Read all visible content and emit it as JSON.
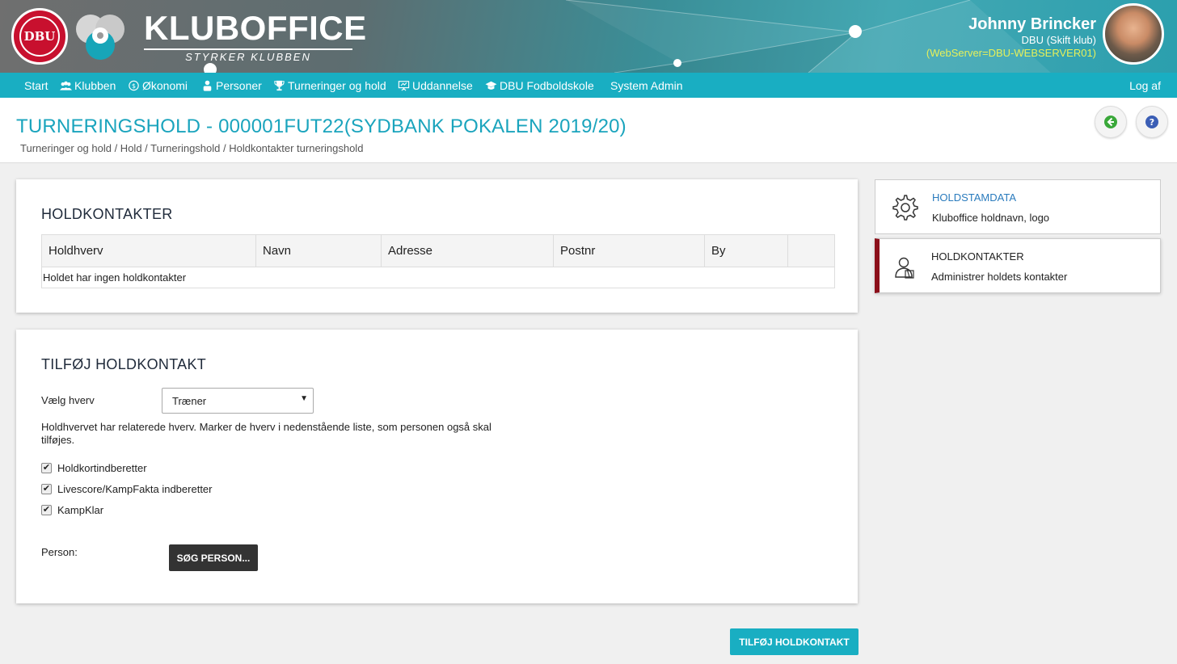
{
  "header": {
    "brand_name": "KLUBOFFICE",
    "brand_tagline": "STYRKER KLUBBEN",
    "logo_text": "DBU",
    "user_name": "Johnny Brincker",
    "user_club": "DBU (Skift klub)",
    "server": "(WebServer=DBU-WEBSERVER01)"
  },
  "nav": {
    "items": [
      {
        "label": "Start",
        "icon": ""
      },
      {
        "label": "Klubben",
        "icon": "people-icon"
      },
      {
        "label": "Økonomi",
        "icon": "coin-icon"
      },
      {
        "label": "Personer",
        "icon": "person-icon"
      },
      {
        "label": "Turneringer og hold",
        "icon": "trophy-icon"
      },
      {
        "label": "Uddannelse",
        "icon": "presentation-icon"
      },
      {
        "label": "DBU Fodboldskole",
        "icon": "graduation-cap-icon"
      },
      {
        "label": "System Admin",
        "icon": ""
      }
    ],
    "logout": "Log af"
  },
  "page": {
    "title": "TURNERINGSHOLD - 000001FUT22(SYDBANK POKALEN 2019/20)",
    "breadcrumb": "Turneringer og hold / Hold / Turneringshold / Holdkontakter turneringshold"
  },
  "contacts": {
    "heading": "HOLDKONTAKTER",
    "columns": [
      "Holdhverv",
      "Navn",
      "Adresse",
      "Postnr",
      "By",
      ""
    ],
    "empty_text": "Holdet har ingen holdkontakter"
  },
  "add_contact": {
    "heading": "TILFØJ HOLDKONTAKT",
    "role_label": "Vælg hverv",
    "role_value": "Træner",
    "info_text_line1": "Holdhvervet har relaterede hverv. Marker de hverv i nedenstående liste, som personen også skal",
    "info_text_line2": "tilføjes.",
    "related_roles": [
      {
        "label": "Holdkortindberetter",
        "checked": true
      },
      {
        "label": "Livescore/KampFakta indberetter",
        "checked": true
      },
      {
        "label": "KampKlar",
        "checked": true
      }
    ],
    "person_label": "Person:",
    "search_button": "SØG PERSON...",
    "submit_button": "TILFØJ HOLDKONTAKT"
  },
  "sidebar": {
    "items": [
      {
        "title": "HOLDSTAMDATA",
        "desc": "Kluboffice holdnavn, logo",
        "icon": "gear-icon",
        "active": false
      },
      {
        "title": "HOLDKONTAKTER",
        "desc": "Administrer holdets kontakter",
        "icon": "contact-person-icon",
        "active": true
      }
    ]
  },
  "colors": {
    "accent": "#19aec2",
    "title": "#1aa4bd",
    "active_marker": "#8b0f1a",
    "server_text": "#e6f05a"
  }
}
